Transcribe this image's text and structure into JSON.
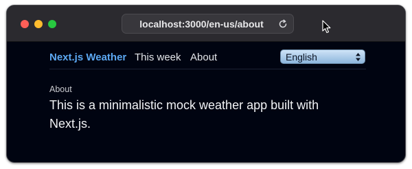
{
  "browser": {
    "url": "localhost:3000/en-us/about",
    "icons": {
      "reload": "reload-icon",
      "cursor": "mouse-pointer-icon"
    }
  },
  "nav": {
    "brand": "Next.js Weather",
    "links": [
      "This week",
      "About"
    ],
    "language": "English",
    "colors": {
      "brand": "#5ca8f2",
      "background": "#000411"
    }
  },
  "page": {
    "section_label": "About",
    "body": "This is a minimalistic mock weather app built with Next.js."
  }
}
